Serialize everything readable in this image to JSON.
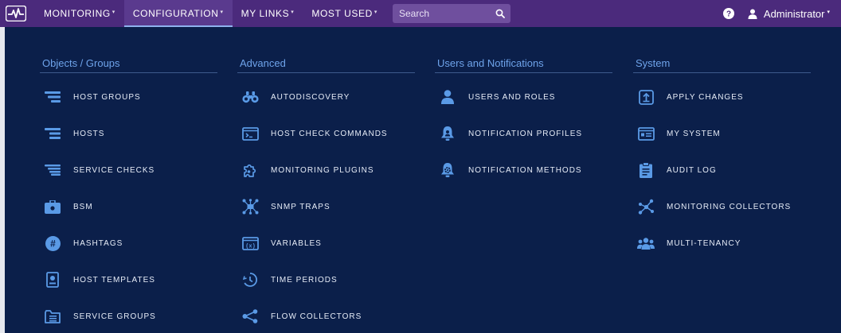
{
  "header": {
    "nav": [
      {
        "label": "MONITORING",
        "caret": "▾"
      },
      {
        "label": "CONFIGURATION",
        "caret": "▾",
        "active": true
      },
      {
        "label": "MY LINKS",
        "caret": "▾"
      },
      {
        "label": "MOST USED",
        "caret": "▾"
      }
    ],
    "search_placeholder": "Search",
    "user_name": "Administrator",
    "user_caret": "▾"
  },
  "columns": [
    {
      "title": "Objects / Groups",
      "items": [
        {
          "label": "HOST GROUPS",
          "icon": "host-groups-icon"
        },
        {
          "label": "HOSTS",
          "icon": "hosts-icon"
        },
        {
          "label": "SERVICE CHECKS",
          "icon": "service-checks-icon"
        },
        {
          "label": "BSM",
          "icon": "briefcase-icon"
        },
        {
          "label": "HASHTAGS",
          "icon": "hashtag-icon"
        },
        {
          "label": "HOST TEMPLATES",
          "icon": "template-icon"
        },
        {
          "label": "SERVICE GROUPS",
          "icon": "folder-list-icon"
        }
      ]
    },
    {
      "title": "Advanced",
      "items": [
        {
          "label": "AUTODISCOVERY",
          "icon": "binoculars-icon"
        },
        {
          "label": "HOST CHECK COMMANDS",
          "icon": "terminal-icon"
        },
        {
          "label": "MONITORING PLUGINS",
          "icon": "puzzle-icon"
        },
        {
          "label": "SNMP TRAPS",
          "icon": "network-icon"
        },
        {
          "label": "VARIABLES",
          "icon": "variables-icon"
        },
        {
          "label": "TIME PERIODS",
          "icon": "clock-history-icon"
        },
        {
          "label": "FLOW COLLECTORS",
          "icon": "share-nodes-icon"
        }
      ]
    },
    {
      "title": "Users and Notifications",
      "items": [
        {
          "label": "USERS AND ROLES",
          "icon": "user-icon"
        },
        {
          "label": "NOTIFICATION PROFILES",
          "icon": "bell-user-icon"
        },
        {
          "label": "NOTIFICATION METHODS",
          "icon": "bell-gear-icon"
        }
      ]
    },
    {
      "title": "System",
      "items": [
        {
          "label": "APPLY CHANGES",
          "icon": "upload-icon"
        },
        {
          "label": "MY SYSTEM",
          "icon": "system-card-icon"
        },
        {
          "label": "AUDIT LOG",
          "icon": "clipboard-icon"
        },
        {
          "label": "MONITORING COLLECTORS",
          "icon": "collector-nodes-icon"
        },
        {
          "label": "MULTI-TENANCY",
          "icon": "users-group-icon"
        }
      ]
    }
  ],
  "colors": {
    "topbar": "#4b2a7c",
    "background": "#0b1f4a",
    "accent": "#6ea3ea",
    "icon": "#5a9ae6"
  }
}
